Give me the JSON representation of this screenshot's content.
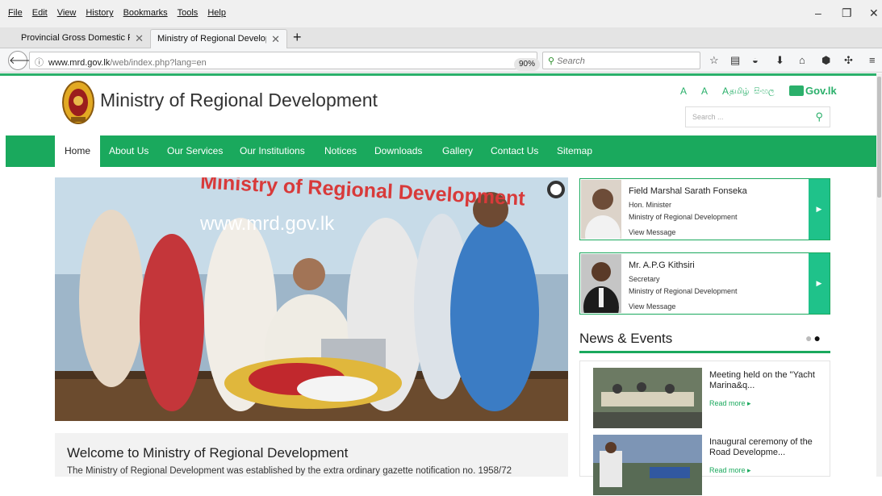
{
  "browser": {
    "menu": [
      "File",
      "Edit",
      "View",
      "History",
      "Bookmarks",
      "Tools",
      "Help"
    ],
    "window_controls": {
      "minimize": "–",
      "restore": "❐",
      "close": "✕"
    },
    "tabs": [
      {
        "label": "Provincial Gross Domestic Produ",
        "active": false
      },
      {
        "label": "Ministry of Regional Developme",
        "active": true
      }
    ],
    "new_tab": "+",
    "tab_close": "✕",
    "url_host": "www.mrd.gov.lk",
    "url_path": "/web/index.php?lang=en",
    "zoom": "90%",
    "search_placeholder": "Search",
    "toolbar_icons": [
      "star-icon",
      "reading-list-icon",
      "pocket-icon",
      "download-icon",
      "home-icon",
      "extension-icon",
      "puzzle-icon",
      "hamburger-menu-icon"
    ]
  },
  "site": {
    "title": "Ministry of Regional Development",
    "font_sizes": "A A A",
    "languages": [
      "தமிழ்",
      "සිංහල"
    ],
    "gov_logo": "Gov.lk",
    "search_placeholder": "Search ...",
    "nav": [
      "Home",
      "About Us",
      "Our Services",
      "Our Institutions",
      "Notices",
      "Downloads",
      "Gallery",
      "Contact Us",
      "Sitemap"
    ],
    "active_nav": "Home",
    "accent_color": "#1aa95d"
  },
  "hero": {
    "banner_title": "Ministry of Regional Development",
    "banner_url": "www.mrd.gov.lk"
  },
  "profiles": [
    {
      "name": "Field Marshal Sarath Fonseka",
      "role": "Hon. Minister",
      "dept": "Ministry of Regional Development",
      "link": "View Message"
    },
    {
      "name": "Mr. A.P.G Kithsiri",
      "role": "Secretary",
      "dept": "Ministry of Regional Development",
      "link": "View Message"
    }
  ],
  "news": {
    "heading": "News & Events",
    "items": [
      {
        "title": "Meeting held on the \"Yacht Marina&q...",
        "more": "Read more ▸"
      },
      {
        "title": "Inaugural ceremony of the Road Developme...",
        "more": "Read more ▸"
      }
    ]
  },
  "welcome": {
    "title": "Welcome to Ministry of Regional Development",
    "text": "The Ministry of Regional Development was established by the extra ordinary gazette notification no. 1958/72"
  }
}
